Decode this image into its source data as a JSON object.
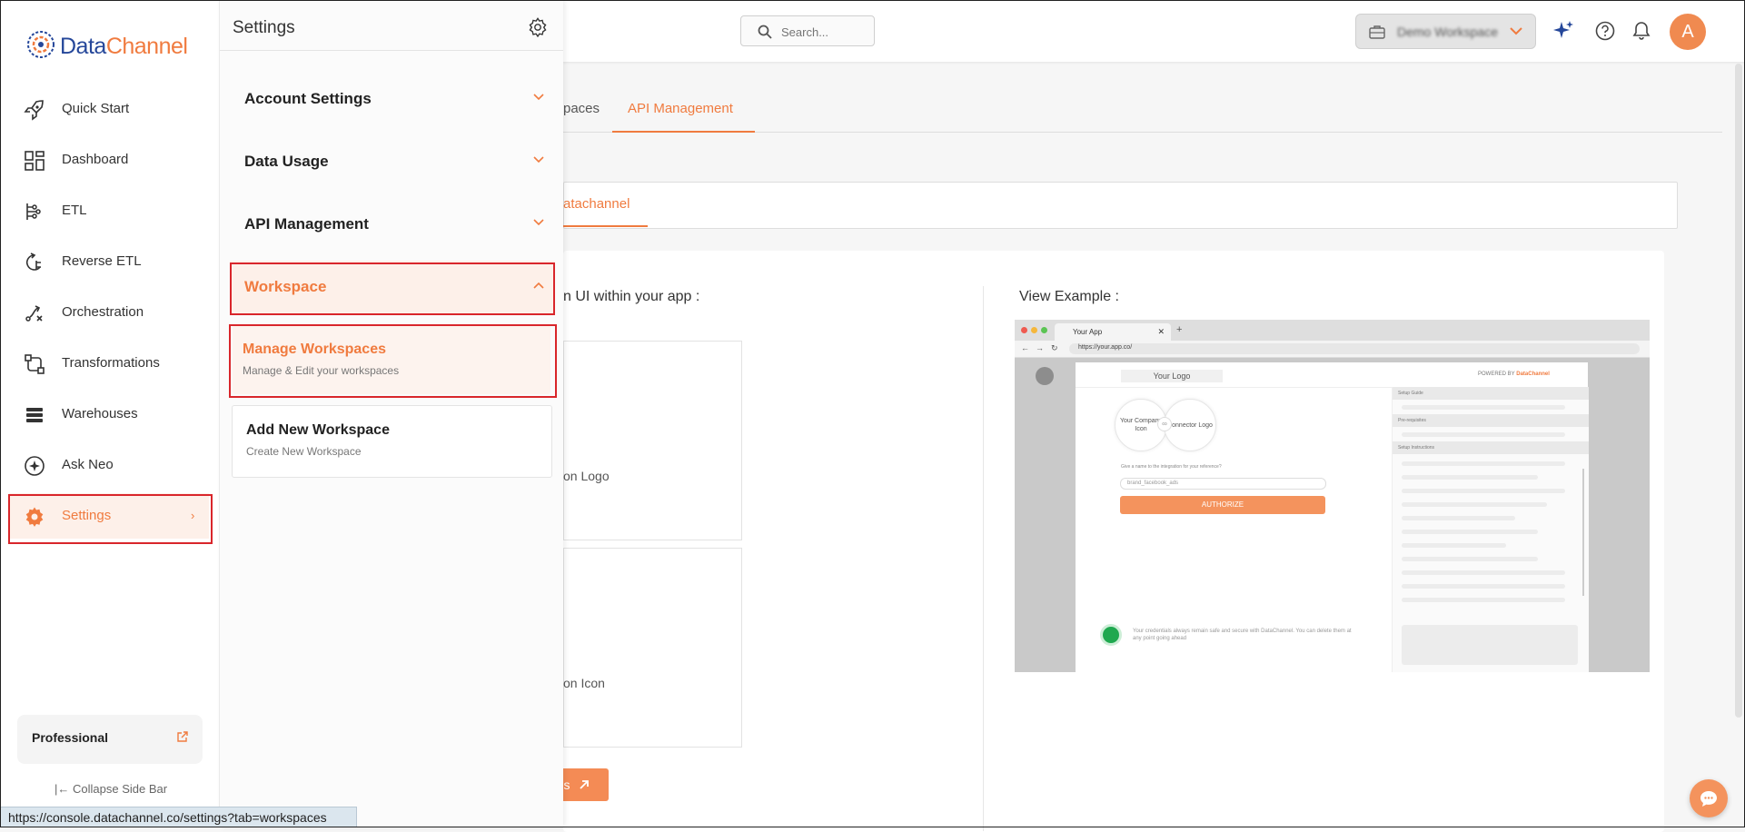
{
  "brand": {
    "name_part1": "Data",
    "name_part2": "Channel",
    "accent": "#f07b3f",
    "primary": "#25479a"
  },
  "topbar": {
    "search_placeholder": "Search...",
    "workspace_name": "Demo Workspace",
    "avatar_initial": "A"
  },
  "sidebar": {
    "items": [
      {
        "label": "Quick Start",
        "icon": "rocket-icon"
      },
      {
        "label": "Dashboard",
        "icon": "dashboard-icon"
      },
      {
        "label": "ETL",
        "icon": "etl-icon"
      },
      {
        "label": "Reverse ETL",
        "icon": "reverse-etl-icon"
      },
      {
        "label": "Orchestration",
        "icon": "orchestration-icon"
      },
      {
        "label": "Transformations",
        "icon": "transformations-icon"
      },
      {
        "label": "Warehouses",
        "icon": "warehouses-icon"
      },
      {
        "label": "Ask Neo",
        "icon": "ask-neo-icon"
      },
      {
        "label": "Settings",
        "icon": "gear-icon",
        "arrow": "›"
      }
    ],
    "plan": "Professional",
    "collapse_label": "Collapse Side Bar"
  },
  "settings_panel": {
    "title": "Settings",
    "sections": [
      {
        "label": "Account Settings"
      },
      {
        "label": "Data Usage"
      },
      {
        "label": "API Management"
      },
      {
        "label": "Workspace"
      }
    ],
    "workspace_items": [
      {
        "title": "Manage Workspaces",
        "subtitle": "Manage & Edit your workspaces"
      },
      {
        "title": "Add New Workspace",
        "subtitle": "Create New Workspace"
      }
    ]
  },
  "main": {
    "tabs": [
      {
        "label": "paces"
      },
      {
        "label": "API Management"
      }
    ],
    "subtab": "atachannel",
    "heading": "n UI within your app :",
    "box1_label": "on Logo",
    "box2_label": "on Icon",
    "docs_button": "s",
    "view_example": "View Example :"
  },
  "preview": {
    "tab_title": "Your App",
    "url": "https://your.app.co/",
    "logo_placeholder": "Your Logo",
    "powered_by": "POWERED BY",
    "powered_brand": "DataChannel",
    "company_icon": "Your Company Icon",
    "connector_logo": "Connector Logo",
    "question": "Give a name to the integration for your reference?",
    "input_value": "brand_facebook_ads",
    "authorize": "AUTHORIZE",
    "note": "Your credentials always remain safe and secure with DataChannel. You can delete them at any point going ahead",
    "side_sections": [
      "Setup Guide",
      "Pre-requisites",
      "Setup Instructions"
    ]
  },
  "status_bar": {
    "url": "https://console.datachannel.co/settings?tab=workspaces"
  }
}
